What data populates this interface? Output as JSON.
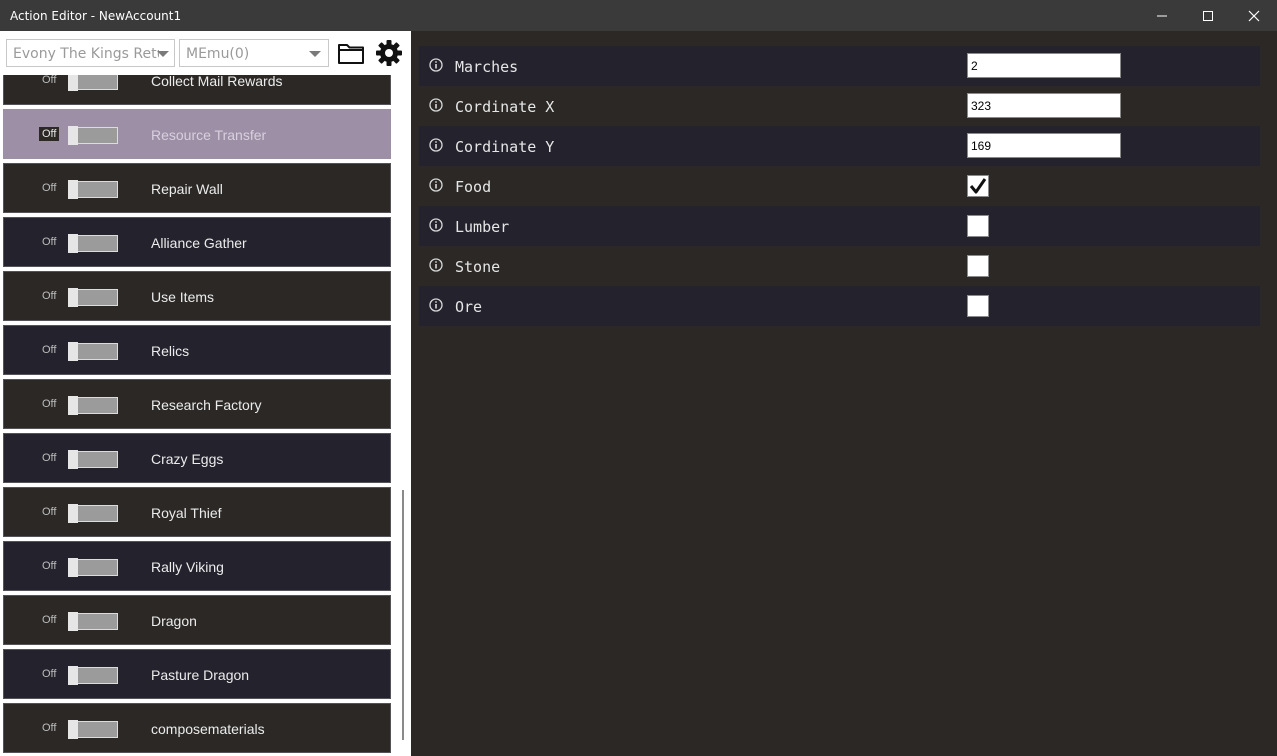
{
  "window": {
    "title": "Action Editor - NewAccount1"
  },
  "toolbar": {
    "game_value": "Evony The Kings Return",
    "emulator_value": "MEmu(0)"
  },
  "actions": [
    {
      "label": "Collect Mail Rewards",
      "state": "Off"
    },
    {
      "label": "Resource Transfer",
      "state": "Off"
    },
    {
      "label": "Repair Wall",
      "state": "Off"
    },
    {
      "label": "Alliance Gather",
      "state": "Off"
    },
    {
      "label": "Use Items",
      "state": "Off"
    },
    {
      "label": "Relics",
      "state": "Off"
    },
    {
      "label": "Research Factory",
      "state": "Off"
    },
    {
      "label": "Crazy Eggs",
      "state": "Off"
    },
    {
      "label": "Royal Thief",
      "state": "Off"
    },
    {
      "label": "Rally Viking",
      "state": "Off"
    },
    {
      "label": "Dragon",
      "state": "Off"
    },
    {
      "label": "Pasture Dragon",
      "state": "Off"
    },
    {
      "label": "composematerials",
      "state": "Off"
    }
  ],
  "selected_action": "Resource Transfer",
  "params": [
    {
      "label": "Marches",
      "type": "text",
      "value": "2"
    },
    {
      "label": "Cordinate X",
      "type": "text",
      "value": "323"
    },
    {
      "label": "Cordinate Y",
      "type": "text",
      "value": "169"
    },
    {
      "label": "Food",
      "type": "checkbox",
      "checked": true
    },
    {
      "label": "Lumber",
      "type": "checkbox",
      "checked": false
    },
    {
      "label": "Stone",
      "type": "checkbox",
      "checked": false
    },
    {
      "label": "Ore",
      "type": "checkbox",
      "checked": false
    }
  ],
  "colors": {
    "selected_row": "#9c8fa6",
    "row_dark": "#24222d",
    "row_brown": "#2b2826"
  }
}
